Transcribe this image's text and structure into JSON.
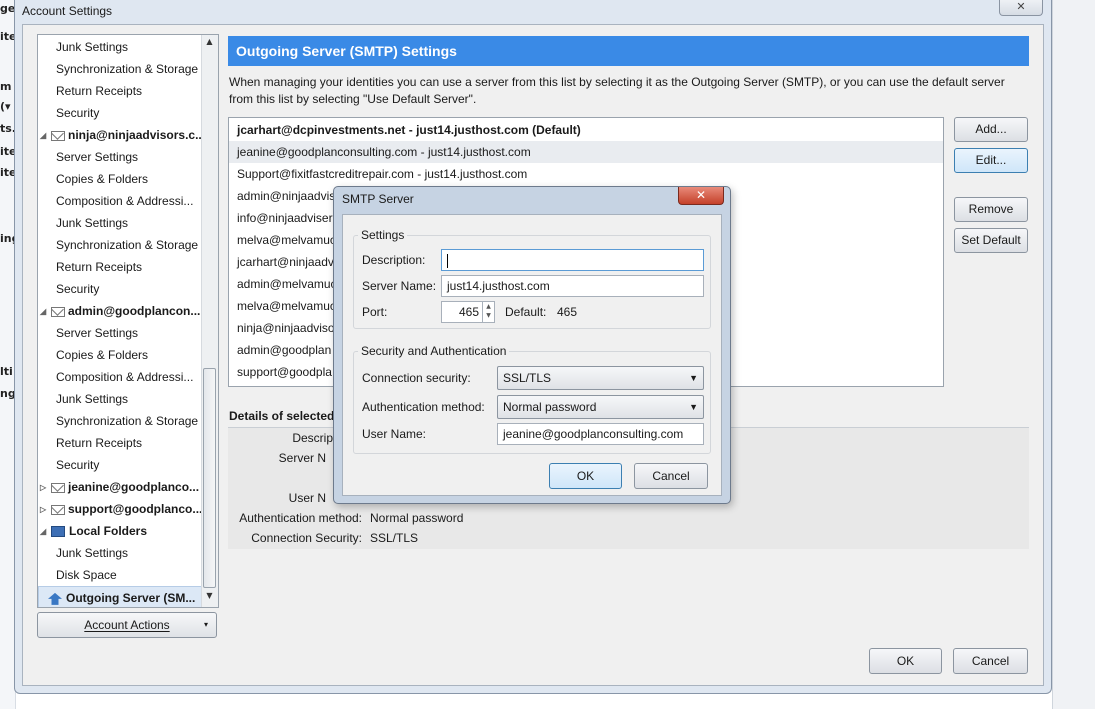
{
  "window": {
    "title": "Account Settings",
    "close_glyph": "✕"
  },
  "tree": {
    "items": [
      {
        "label": "Junk Settings",
        "kind": "child"
      },
      {
        "label": "Synchronization & Storage",
        "kind": "child"
      },
      {
        "label": "Return Receipts",
        "kind": "child"
      },
      {
        "label": "Security",
        "kind": "child"
      },
      {
        "label": "ninja@ninjaadvisors.c...",
        "kind": "account"
      },
      {
        "label": "Server Settings",
        "kind": "child"
      },
      {
        "label": "Copies & Folders",
        "kind": "child"
      },
      {
        "label": "Composition & Addressi...",
        "kind": "child"
      },
      {
        "label": "Junk Settings",
        "kind": "child"
      },
      {
        "label": "Synchronization & Storage",
        "kind": "child"
      },
      {
        "label": "Return Receipts",
        "kind": "child"
      },
      {
        "label": "Security",
        "kind": "child"
      },
      {
        "label": "admin@goodplancon...",
        "kind": "account"
      },
      {
        "label": "Server Settings",
        "kind": "child"
      },
      {
        "label": "Copies & Folders",
        "kind": "child"
      },
      {
        "label": "Composition & Addressi...",
        "kind": "child"
      },
      {
        "label": "Junk Settings",
        "kind": "child"
      },
      {
        "label": "Synchronization & Storage",
        "kind": "child"
      },
      {
        "label": "Return Receipts",
        "kind": "child"
      },
      {
        "label": "Security",
        "kind": "child"
      },
      {
        "label": "jeanine@goodplanco...",
        "kind": "account-collapsed"
      },
      {
        "label": "support@goodplanco...",
        "kind": "account-collapsed"
      },
      {
        "label": "Local Folders",
        "kind": "local"
      },
      {
        "label": "Junk Settings",
        "kind": "child"
      },
      {
        "label": "Disk Space",
        "kind": "child"
      },
      {
        "label": "Outgoing Server (SM...",
        "kind": "smtp"
      }
    ],
    "account_actions_label": "Account Actions"
  },
  "panel": {
    "header": "Outgoing Server (SMTP) Settings",
    "description": "When managing your identities you can use a server from this list by selecting it as the Outgoing Server (SMTP), or you can use the default server from this list by selecting \"Use Default Server\".",
    "servers": [
      "jcarhart@dcpinvestments.net - just14.justhost.com (Default)",
      "jeanine@goodplanconsulting.com - just14.justhost.com",
      "Support@fixitfastcreditrepair.com - just14.justhost.com",
      "admin@ninjaadvis",
      "info@ninjaadvisers",
      "melva@melvamuc",
      "jcarhart@ninjaadvi",
      "admin@melvamuc",
      "melva@melvamuc",
      "ninja@ninjaadviso",
      "admin@goodplan",
      "support@goodpla"
    ],
    "buttons": {
      "add": "Add...",
      "edit": "Edit...",
      "remove": "Remove",
      "set_default": "Set Default"
    },
    "details_title": "Details of selected",
    "details": {
      "description_label": "Descrip",
      "server_name_label": "Server N",
      "user_name_label": "User N",
      "auth_label": "Authentication method:",
      "auth_value": "Normal password",
      "conn_label": "Connection Security:",
      "conn_value": "SSL/TLS"
    }
  },
  "footer": {
    "ok": "OK",
    "cancel": "Cancel"
  },
  "modal": {
    "title": "SMTP Server",
    "close_glyph": "✕",
    "settings_group": "Settings",
    "description_label": "Description:",
    "description_value": "",
    "server_name_label": "Server Name:",
    "server_name_value": "just14.justhost.com",
    "port_label": "Port:",
    "port_value": "465",
    "default_label": "Default:",
    "default_value": "465",
    "security_group": "Security and Authentication",
    "conn_security_label": "Connection security:",
    "conn_security_value": "SSL/TLS",
    "auth_method_label": "Authentication method:",
    "auth_method_value": "Normal password",
    "user_name_label": "User Name:",
    "user_name_value": "jeanine@goodplanconsulting.com",
    "ok": "OK",
    "cancel": "Cancel"
  },
  "colors": {
    "accent": "#3a8ae6",
    "close_red": "#c5412a"
  }
}
